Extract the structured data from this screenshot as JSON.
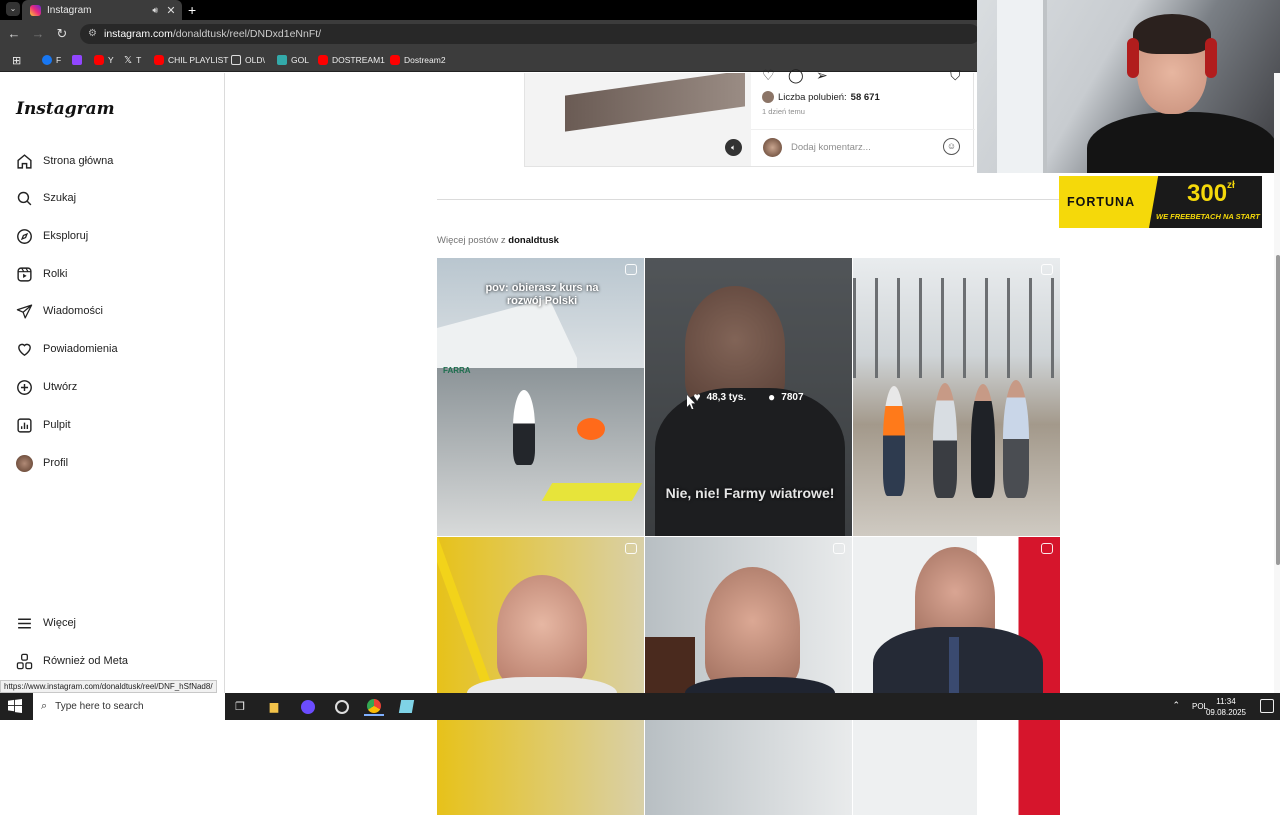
{
  "browser": {
    "tab_title": "Instagram",
    "url_host": "instagram.com",
    "url_path": "/donaldtusk/reel/DNDxd1eNnFt/",
    "bookmarks": [
      {
        "label": "F",
        "color": "#1877f2"
      },
      {
        "label": "",
        "color": "#9146ff"
      },
      {
        "label": "Y",
        "color": "#ff0000"
      },
      {
        "label": "T",
        "color": "#000000"
      },
      {
        "label": "CHIL PLAYLIST",
        "color": "#ff0000"
      },
      {
        "label": "OLD\\",
        "color": "#dddddd"
      },
      {
        "label": "GOL",
        "color": "#3aa"
      },
      {
        "label": "DOSTREAM1",
        "color": "#ff0000"
      },
      {
        "label": "Dostream2",
        "color": "#ff0000"
      }
    ]
  },
  "sidebar": {
    "logo": "Instagram",
    "items": [
      {
        "label": "Strona główna",
        "icon": "home-icon"
      },
      {
        "label": "Szukaj",
        "icon": "search-icon"
      },
      {
        "label": "Eksploruj",
        "icon": "compass-icon"
      },
      {
        "label": "Rolki",
        "icon": "reels-icon"
      },
      {
        "label": "Wiadomości",
        "icon": "send-icon"
      },
      {
        "label": "Powiadomienia",
        "icon": "heart-icon"
      },
      {
        "label": "Utwórz",
        "icon": "plus-icon"
      },
      {
        "label": "Pulpit",
        "icon": "dashboard-icon"
      },
      {
        "label": "Profil",
        "icon": "avatar"
      }
    ],
    "bottom_items": [
      {
        "label": "Więcej",
        "icon": "menu-icon"
      },
      {
        "label": "Również od Meta",
        "icon": "meta-icon"
      }
    ]
  },
  "post": {
    "likes_label": "Liczba polubień: ",
    "likes_count": "58 671",
    "date": "1 dzień temu",
    "comment_placeholder": "Dodaj komentarz..."
  },
  "more_posts": {
    "prefix": "Więcej postów z ",
    "username": "donaldtusk"
  },
  "grid": [
    {
      "caption": "pov: obierasz kurs na rozwój Polski",
      "boat_label": "FARRA"
    },
    {
      "caption": "Nie, nie! Farmy wiatrowe!",
      "likes": "48,3 tys.",
      "comments": "7807"
    },
    {
      "caption": ""
    },
    {
      "caption": ""
    },
    {
      "caption": ""
    },
    {
      "caption": ""
    }
  ],
  "ad": {
    "brand": "FORTUNA",
    "amount": "300",
    "currency": "zł",
    "tagline": "WE FREEBETACH NA START"
  },
  "status_link": "https://www.instagram.com/donaldtusk/reel/DNF_hSfNad8/",
  "taskbar": {
    "search_placeholder": "Type here to search",
    "language": "POL",
    "time": "11:34",
    "date": "09.08.2025"
  }
}
